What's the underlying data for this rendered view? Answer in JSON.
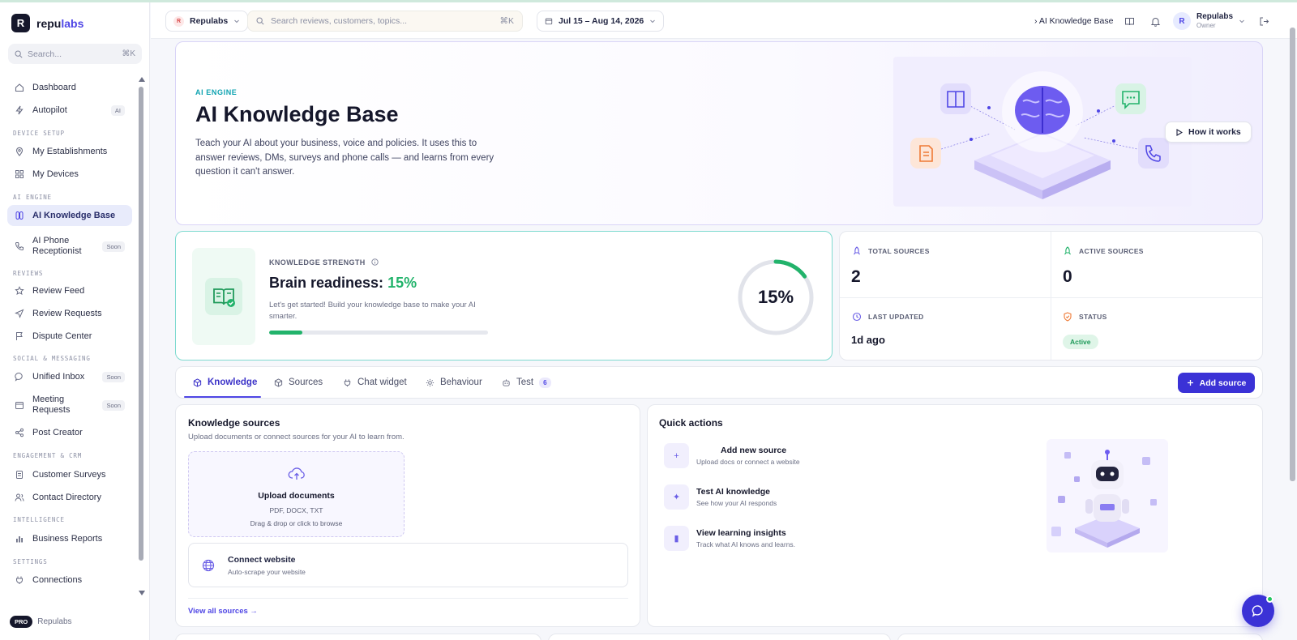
{
  "app": {
    "name_a": "repu",
    "name_b": "labs",
    "logo_letter": "R"
  },
  "sidebar": {
    "search_placeholder": "Search...",
    "search_shortcut": "⌘K",
    "sections": {
      "device_setup": "DEVICE SETUP",
      "ai_engine": "AI ENGINE",
      "reviews": "REVIEWS",
      "social": "SOCIAL & MESSAGING",
      "engagement": "ENGAGEMENT & CRM",
      "intelligence": "INTELLIGENCE",
      "settings": "SETTINGS"
    },
    "items": {
      "dashboard": "Dashboard",
      "autopilot": "Autopilot",
      "autopilot_tag": "AI",
      "establishments": "My Establishments",
      "devices": "My Devices",
      "knowledge_base": "AI Knowledge Base",
      "phone_receptionist": "AI Phone Receptionist",
      "phone_tag": "Soon",
      "review_feed": "Review Feed",
      "review_requests": "Review Requests",
      "dispute_center": "Dispute Center",
      "unified_inbox": "Unified Inbox",
      "inbox_tag": "Soon",
      "meeting_requests": "Meeting Requests",
      "meeting_tag": "Soon",
      "post_creator": "Post Creator",
      "customer_surveys": "Customer Surveys",
      "contact_directory": "Contact Directory",
      "business_reports": "Business Reports",
      "connections": "Connections"
    },
    "footer": {
      "badge": "PRO",
      "org": "Repulabs"
    }
  },
  "topbar": {
    "org_letter": "R",
    "org_name": "Repulabs",
    "search_placeholder": "Search reviews, customers, topics...",
    "search_shortcut": "⌘K",
    "date_range": "Jul 15 – Aug 14, 2026",
    "breadcrumb": "› AI Knowledge Base",
    "user_initial": "R",
    "user_name": "Repulabs",
    "user_role": "Owner"
  },
  "hero": {
    "kicker": "AI ENGINE",
    "title": "AI Knowledge Base",
    "description": "Teach your AI about your business, voice and policies. It uses this to answer reviews, DMs, surveys and phone calls — and learns from every question it can't answer.",
    "how_button": "How it works"
  },
  "strength": {
    "kicker": "KNOWLEDGE STRENGTH",
    "title_prefix": "Brain readiness: ",
    "percent_text": "15%",
    "ring_text": "15%",
    "readiness": 0.15,
    "description": "Let's get started! Build your knowledge base to make your AI smarter."
  },
  "stats": {
    "total_label": "TOTAL SOURCES",
    "total_value": "2",
    "active_label": "ACTIVE SOURCES",
    "active_value": "0",
    "updated_label": "LAST UPDATED",
    "updated_value": "1d ago",
    "status_label": "STATUS",
    "status_value": "Active"
  },
  "tabs": {
    "knowledge": "Knowledge",
    "sources": "Sources",
    "chat_widget": "Chat widget",
    "behaviour": "Behaviour",
    "test": "Test",
    "test_badge": "6",
    "add_source": "Add source"
  },
  "knowledge_sources": {
    "title": "Knowledge sources",
    "subtitle": "Upload documents or connect sources for your AI to learn from.",
    "upload_title": "Upload documents",
    "upload_types": "PDF, DOCX, TXT",
    "upload_hint": "Drag & drop or click to browse",
    "connect_title": "Connect website",
    "connect_sub": "Auto-scrape your website",
    "view_all": "View all sources →"
  },
  "quick_actions": {
    "title": "Quick actions",
    "items": [
      {
        "title": "Add new source",
        "sub": "Upload docs or connect a website",
        "icon": "+"
      },
      {
        "title": "Test AI knowledge",
        "sub": "See how your AI responds",
        "icon": "✦"
      },
      {
        "title": "View learning insights",
        "sub": "Track what AI knows and learns.",
        "icon": "▮"
      }
    ]
  },
  "colors": {
    "accent": "#3b32d6",
    "success": "#22b36b",
    "teal": "#0fa3b1"
  }
}
